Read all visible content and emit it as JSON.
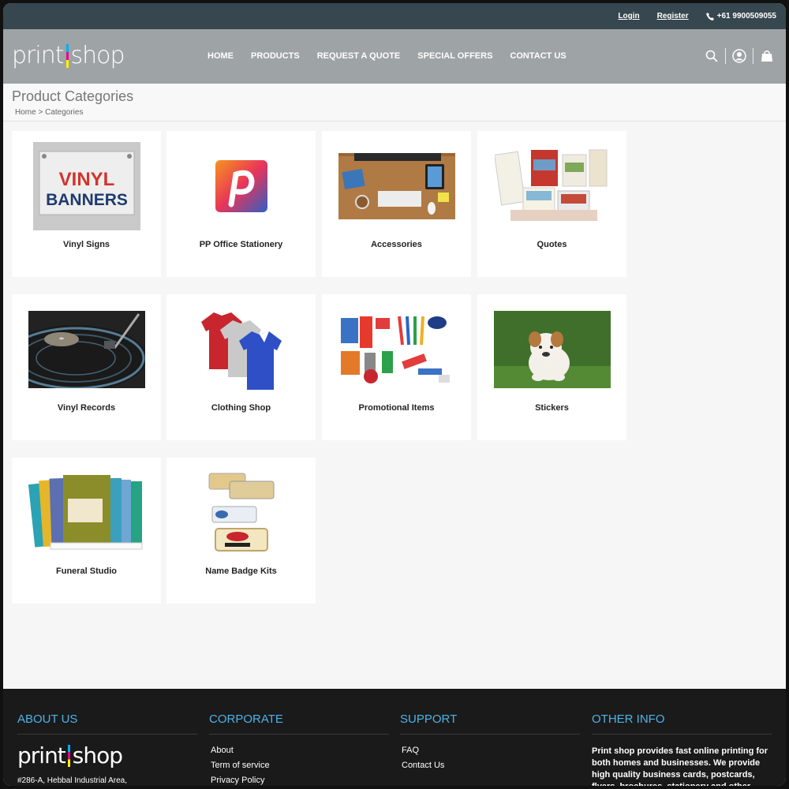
{
  "topbar": {
    "login": "Login",
    "register": "Register",
    "phone": "+61 9900509055"
  },
  "header": {
    "logo_left": "print",
    "logo_right": "shop",
    "nav": [
      "HOME",
      "PRODUCTS",
      "REQUEST A QUOTE",
      "SPECIAL OFFERS",
      "CONTACT US"
    ],
    "icons": [
      "search-icon",
      "user-icon",
      "bag-icon"
    ]
  },
  "page": {
    "title": "Product Categories",
    "breadcrumb": {
      "home": "Home",
      "sep": " > ",
      "current": "Categories"
    }
  },
  "categories": [
    {
      "label": "Vinyl Signs",
      "icon": "vinyl-banner-image"
    },
    {
      "label": "PP Office Stationery",
      "icon": "pp-logo-image"
    },
    {
      "label": "Accessories",
      "icon": "desk-accessories-image"
    },
    {
      "label": "Quotes",
      "icon": "brochures-image"
    },
    {
      "label": "Vinyl Records",
      "icon": "turntable-image"
    },
    {
      "label": "Clothing Shop",
      "icon": "polo-shirts-image"
    },
    {
      "label": "Promotional Items",
      "icon": "promo-items-image"
    },
    {
      "label": "Stickers",
      "icon": "puppy-image"
    },
    {
      "label": "Funeral Studio",
      "icon": "booklets-image"
    },
    {
      "label": "Name Badge Kits",
      "icon": "name-badges-image"
    }
  ],
  "banner_text": {
    "line1": "VINYL",
    "line2": "BANNERS"
  },
  "footer": {
    "about": {
      "title": "ABOUT US",
      "logo_left": "print",
      "logo_right": "shop",
      "address": "#286-A, Hebbal Industrial Area,"
    },
    "corporate": {
      "title": "CORPORATE",
      "links": [
        "About",
        "Term of service",
        "Privacy Policy"
      ]
    },
    "support": {
      "title": "SUPPORT",
      "links": [
        "FAQ",
        "Contact Us"
      ]
    },
    "other": {
      "title": "OTHER INFO",
      "text": "Print shop provides fast online printing for both homes and businesses. We provide high quality business cards, postcards, flyers, brochures, stationery and other premium"
    }
  },
  "colors": {
    "topbar": "#37474f",
    "header": "#9ea3a6",
    "footer": "#1a1a1a",
    "accent": "#4fb3e8"
  }
}
